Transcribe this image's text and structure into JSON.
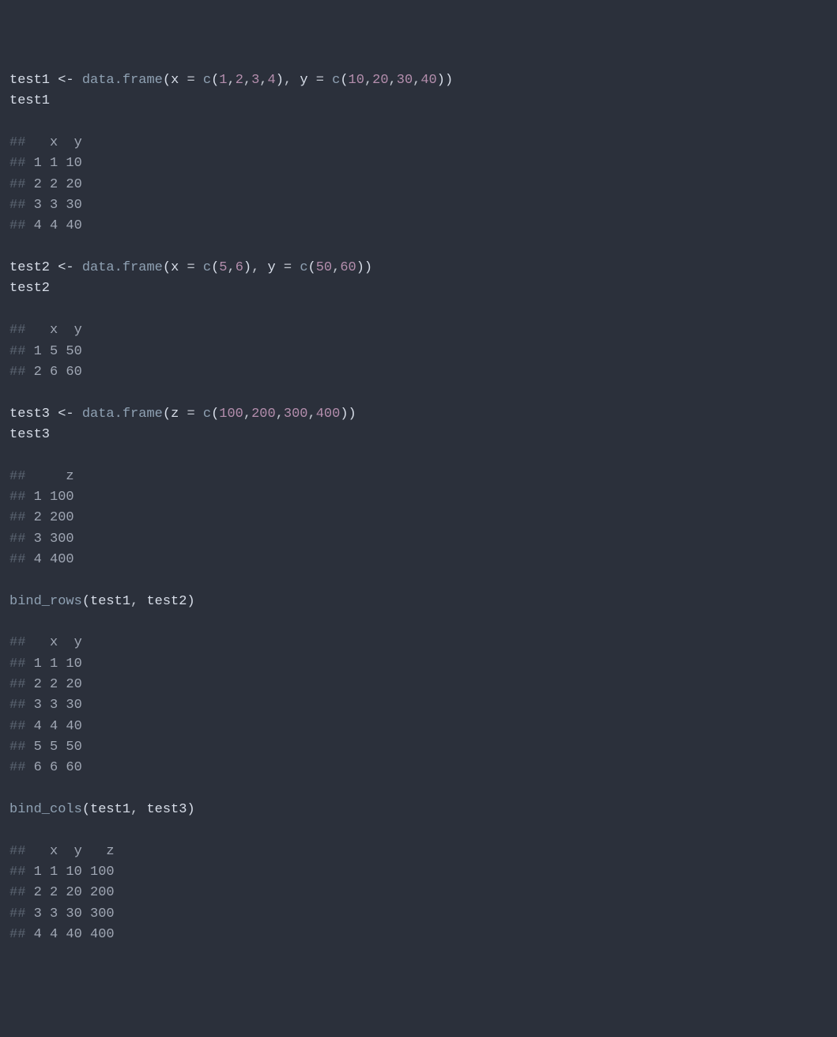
{
  "lines": [
    {
      "type": "code",
      "tokens": [
        {
          "c": "ident",
          "t": "test1"
        },
        {
          "c": "assign",
          "t": " <- "
        },
        {
          "c": "func",
          "t": "data.frame"
        },
        {
          "c": "paren",
          "t": "("
        },
        {
          "c": "argname",
          "t": "x"
        },
        {
          "c": "eq",
          "t": " = "
        },
        {
          "c": "func",
          "t": "c"
        },
        {
          "c": "paren",
          "t": "("
        },
        {
          "c": "num",
          "t": "1"
        },
        {
          "c": "comma",
          "t": ","
        },
        {
          "c": "num",
          "t": "2"
        },
        {
          "c": "comma",
          "t": ","
        },
        {
          "c": "num",
          "t": "3"
        },
        {
          "c": "comma",
          "t": ","
        },
        {
          "c": "num",
          "t": "4"
        },
        {
          "c": "paren",
          "t": ")"
        },
        {
          "c": "comma",
          "t": ", "
        },
        {
          "c": "argname",
          "t": "y"
        },
        {
          "c": "eq",
          "t": " = "
        },
        {
          "c": "func",
          "t": "c"
        },
        {
          "c": "paren",
          "t": "("
        },
        {
          "c": "num",
          "t": "10"
        },
        {
          "c": "comma",
          "t": ","
        },
        {
          "c": "num",
          "t": "20"
        },
        {
          "c": "comma",
          "t": ","
        },
        {
          "c": "num",
          "t": "30"
        },
        {
          "c": "comma",
          "t": ","
        },
        {
          "c": "num",
          "t": "40"
        },
        {
          "c": "paren",
          "t": "))"
        }
      ]
    },
    {
      "type": "code",
      "tokens": [
        {
          "c": "ident",
          "t": "test1"
        }
      ]
    },
    {
      "type": "blank"
    },
    {
      "type": "out",
      "hash": "##",
      "text": "   x  y"
    },
    {
      "type": "out",
      "hash": "##",
      "text": " 1 1 10"
    },
    {
      "type": "out",
      "hash": "##",
      "text": " 2 2 20"
    },
    {
      "type": "out",
      "hash": "##",
      "text": " 3 3 30"
    },
    {
      "type": "out",
      "hash": "##",
      "text": " 4 4 40"
    },
    {
      "type": "blank"
    },
    {
      "type": "code",
      "tokens": [
        {
          "c": "ident",
          "t": "test2"
        },
        {
          "c": "assign",
          "t": " <- "
        },
        {
          "c": "func",
          "t": "data.frame"
        },
        {
          "c": "paren",
          "t": "("
        },
        {
          "c": "argname",
          "t": "x"
        },
        {
          "c": "eq",
          "t": " = "
        },
        {
          "c": "func",
          "t": "c"
        },
        {
          "c": "paren",
          "t": "("
        },
        {
          "c": "num",
          "t": "5"
        },
        {
          "c": "comma",
          "t": ","
        },
        {
          "c": "num",
          "t": "6"
        },
        {
          "c": "paren",
          "t": ")"
        },
        {
          "c": "comma",
          "t": ", "
        },
        {
          "c": "argname",
          "t": "y"
        },
        {
          "c": "eq",
          "t": " = "
        },
        {
          "c": "func",
          "t": "c"
        },
        {
          "c": "paren",
          "t": "("
        },
        {
          "c": "num",
          "t": "50"
        },
        {
          "c": "comma",
          "t": ","
        },
        {
          "c": "num",
          "t": "60"
        },
        {
          "c": "paren",
          "t": "))"
        }
      ]
    },
    {
      "type": "code",
      "tokens": [
        {
          "c": "ident",
          "t": "test2"
        }
      ]
    },
    {
      "type": "blank"
    },
    {
      "type": "out",
      "hash": "##",
      "text": "   x  y"
    },
    {
      "type": "out",
      "hash": "##",
      "text": " 1 5 50"
    },
    {
      "type": "out",
      "hash": "##",
      "text": " 2 6 60"
    },
    {
      "type": "blank"
    },
    {
      "type": "code",
      "tokens": [
        {
          "c": "ident",
          "t": "test3"
        },
        {
          "c": "assign",
          "t": " <- "
        },
        {
          "c": "func",
          "t": "data.frame"
        },
        {
          "c": "paren",
          "t": "("
        },
        {
          "c": "argname",
          "t": "z"
        },
        {
          "c": "eq",
          "t": " = "
        },
        {
          "c": "func",
          "t": "c"
        },
        {
          "c": "paren",
          "t": "("
        },
        {
          "c": "num",
          "t": "100"
        },
        {
          "c": "comma",
          "t": ","
        },
        {
          "c": "num",
          "t": "200"
        },
        {
          "c": "comma",
          "t": ","
        },
        {
          "c": "num",
          "t": "300"
        },
        {
          "c": "comma",
          "t": ","
        },
        {
          "c": "num",
          "t": "400"
        },
        {
          "c": "paren",
          "t": "))"
        }
      ]
    },
    {
      "type": "code",
      "tokens": [
        {
          "c": "ident",
          "t": "test3"
        }
      ]
    },
    {
      "type": "blank"
    },
    {
      "type": "out",
      "hash": "##",
      "text": "     z"
    },
    {
      "type": "out",
      "hash": "##",
      "text": " 1 100"
    },
    {
      "type": "out",
      "hash": "##",
      "text": " 2 200"
    },
    {
      "type": "out",
      "hash": "##",
      "text": " 3 300"
    },
    {
      "type": "out",
      "hash": "##",
      "text": " 4 400"
    },
    {
      "type": "blank"
    },
    {
      "type": "code",
      "tokens": [
        {
          "c": "func",
          "t": "bind_rows"
        },
        {
          "c": "paren",
          "t": "("
        },
        {
          "c": "ident",
          "t": "test1"
        },
        {
          "c": "comma",
          "t": ", "
        },
        {
          "c": "ident",
          "t": "test2"
        },
        {
          "c": "paren",
          "t": ")"
        }
      ]
    },
    {
      "type": "blank"
    },
    {
      "type": "out",
      "hash": "##",
      "text": "   x  y"
    },
    {
      "type": "out",
      "hash": "##",
      "text": " 1 1 10"
    },
    {
      "type": "out",
      "hash": "##",
      "text": " 2 2 20"
    },
    {
      "type": "out",
      "hash": "##",
      "text": " 3 3 30"
    },
    {
      "type": "out",
      "hash": "##",
      "text": " 4 4 40"
    },
    {
      "type": "out",
      "hash": "##",
      "text": " 5 5 50"
    },
    {
      "type": "out",
      "hash": "##",
      "text": " 6 6 60"
    },
    {
      "type": "blank"
    },
    {
      "type": "code",
      "tokens": [
        {
          "c": "func",
          "t": "bind_cols"
        },
        {
          "c": "paren",
          "t": "("
        },
        {
          "c": "ident",
          "t": "test1"
        },
        {
          "c": "comma",
          "t": ", "
        },
        {
          "c": "ident",
          "t": "test3"
        },
        {
          "c": "paren",
          "t": ")"
        }
      ]
    },
    {
      "type": "blank"
    },
    {
      "type": "out",
      "hash": "##",
      "text": "   x  y   z"
    },
    {
      "type": "out",
      "hash": "##",
      "text": " 1 1 10 100"
    },
    {
      "type": "out",
      "hash": "##",
      "text": " 2 2 20 200"
    },
    {
      "type": "out",
      "hash": "##",
      "text": " 3 3 30 300"
    },
    {
      "type": "out",
      "hash": "##",
      "text": " 4 4 40 400"
    }
  ]
}
